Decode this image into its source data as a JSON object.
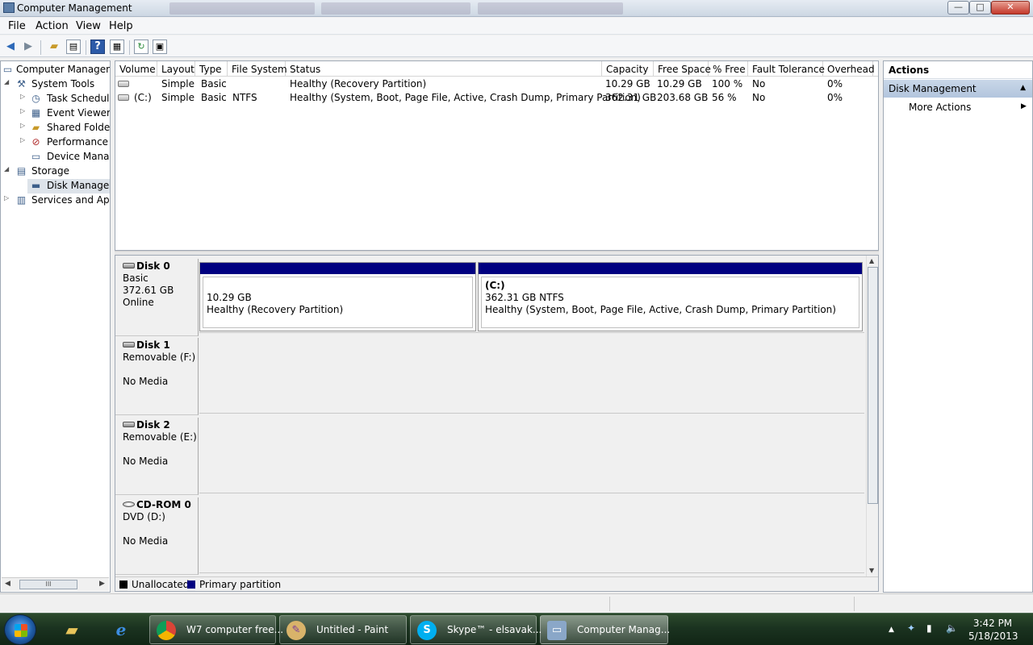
{
  "window": {
    "title": "Computer Management",
    "bg_tabs": [
      "W7 computer free...",
      "Untitled - Paint",
      "Skype"
    ],
    "buttons": {
      "minimize": "—",
      "maximize": "□",
      "close": "✕"
    }
  },
  "menu": [
    "File",
    "Action",
    "View",
    "Help"
  ],
  "toolbar": {
    "icons": [
      "back-arrow-icon",
      "forward-arrow-icon",
      "folder-up-icon",
      "show-hide-tree-icon",
      "help-icon",
      "properties-icon",
      "refresh-icon",
      "export-list-icon"
    ]
  },
  "tree": {
    "items": [
      {
        "label": "Computer Manageme",
        "icon": "computer-icon"
      },
      {
        "label": "System Tools",
        "icon": "tools-icon"
      },
      {
        "label": "Task Scheduler",
        "icon": "clock-icon"
      },
      {
        "label": "Event Viewer",
        "icon": "event-viewer-icon"
      },
      {
        "label": "Shared Folders",
        "icon": "shared-folder-icon"
      },
      {
        "label": "Performance",
        "icon": "performance-icon"
      },
      {
        "label": "Device Manage",
        "icon": "device-manager-icon"
      },
      {
        "label": "Storage",
        "icon": "storage-icon"
      },
      {
        "label": "Disk Managem",
        "icon": "disk-icon"
      },
      {
        "label": "Services and Appli",
        "icon": "services-icon"
      }
    ],
    "hscroll_thumb": "III"
  },
  "volumes": {
    "columns": [
      "Volume",
      "Layout",
      "Type",
      "File System",
      "Status",
      "Capacity",
      "Free Space",
      "% Free",
      "Fault Tolerance",
      "Overhead"
    ],
    "rows": [
      {
        "volume": "",
        "layout": "Simple",
        "type": "Basic",
        "fs": "",
        "status": "Healthy (Recovery Partition)",
        "capacity": "10.29 GB",
        "free": "10.29 GB",
        "pct": "100 %",
        "fault": "No",
        "overhead": "0%"
      },
      {
        "volume": "(C:)",
        "layout": "Simple",
        "type": "Basic",
        "fs": "NTFS",
        "status": "Healthy (System, Boot, Page File, Active, Crash Dump, Primary Partition)",
        "capacity": "362.31 GB",
        "free": "203.68 GB",
        "pct": "56 %",
        "fault": "No",
        "overhead": "0%"
      }
    ]
  },
  "disks": [
    {
      "name": "Disk 0",
      "line1": "Basic",
      "line2": "372.61 GB",
      "line3": "Online"
    },
    {
      "name": "Disk 1",
      "line1": "Removable (F:)",
      "line2": "",
      "line3": "No Media"
    },
    {
      "name": "Disk 2",
      "line1": "Removable (E:)",
      "line2": "",
      "line3": "No Media"
    },
    {
      "name": "CD-ROM 0",
      "line1": "DVD (D:)",
      "line2": "",
      "line3": "No Media"
    }
  ],
  "partitions": [
    {
      "title": "",
      "size": "10.29 GB",
      "status": "Healthy (Recovery Partition)"
    },
    {
      "title": "(C:)",
      "size": "362.31 GB NTFS",
      "status": "Healthy (System, Boot, Page File, Active, Crash Dump, Primary Partition)"
    }
  ],
  "legend": [
    {
      "label": "Unallocated",
      "color": "#000000"
    },
    {
      "label": "Primary partition",
      "color": "#000080"
    }
  ],
  "actions": {
    "header": "Actions",
    "section": "Disk Management",
    "items": [
      "More Actions"
    ]
  },
  "taskbar": {
    "tasks": [
      {
        "label": "W7 computer free...",
        "icon": "chrome-icon"
      },
      {
        "label": "Untitled - Paint",
        "icon": "paint-icon"
      },
      {
        "label": "Skype™ - elsavak...",
        "icon": "skype-icon"
      },
      {
        "label": "Computer Manag...",
        "icon": "computer-management-icon"
      }
    ],
    "time": "3:42 PM",
    "date": "5/18/2013"
  },
  "colors": {
    "primary_partition": "#000080",
    "actions_header": "#c9d7e8",
    "taskbar": "#1b3320"
  }
}
